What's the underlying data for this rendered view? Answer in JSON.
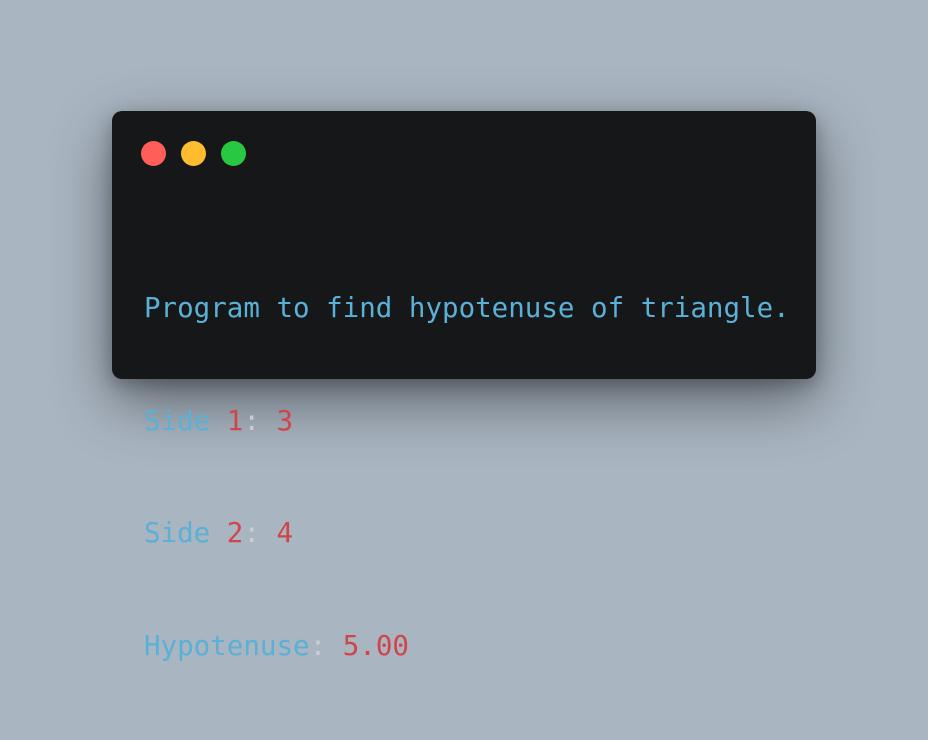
{
  "window": {
    "controls": [
      {
        "name": "close",
        "color": "#ff5f57"
      },
      {
        "name": "minimize",
        "color": "#febc2e"
      },
      {
        "name": "zoom",
        "color": "#28c840"
      }
    ]
  },
  "output": {
    "line1": "Program to find hypotenuse of triangle.",
    "line2": {
      "label": "Side ",
      "index": "1",
      "sep": ": ",
      "value": "3"
    },
    "line3": {
      "label": "Side ",
      "index": "2",
      "sep": ": ",
      "value": "4"
    },
    "line4": {
      "label": "Hypotenuse",
      "sep": ": ",
      "value": "5.00"
    }
  },
  "colors": {
    "background": "#a9b5c1",
    "window": "#161719",
    "text_blue": "#5ab0d6",
    "text_red": "#d0454a",
    "text_light": "#c9ced4"
  }
}
